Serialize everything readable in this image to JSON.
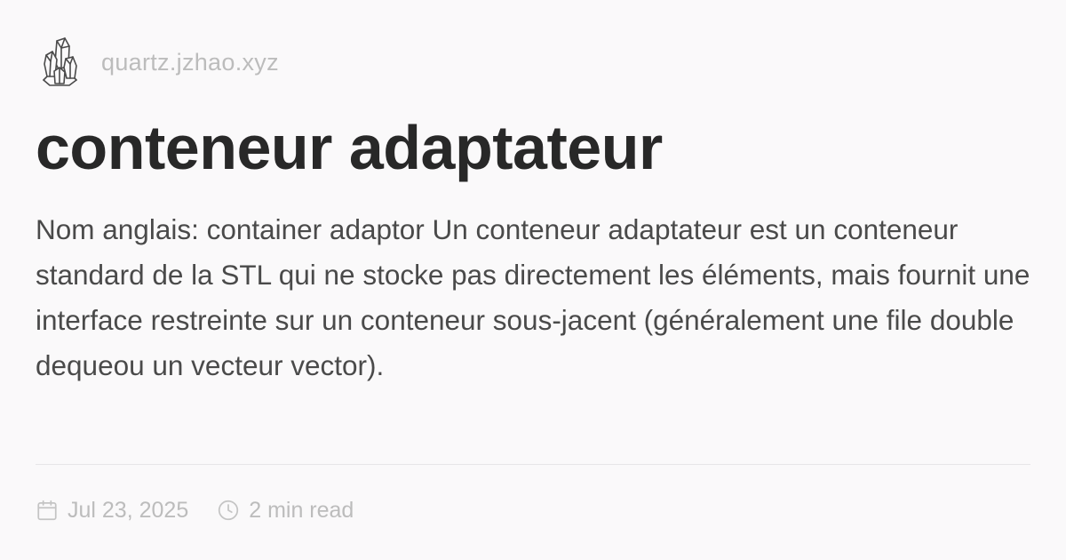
{
  "site": {
    "url": "quartz.jzhao.xyz",
    "logo_icon": "crystal-cluster-icon"
  },
  "page": {
    "title": "conteneur adaptateur",
    "description": "Nom anglais: container adaptor Un conteneur adaptateur est un conteneur standard de la STL qui ne stocke pas directement les éléments, mais fournit une interface restreinte sur un conteneur sous-jacent (généralement une file double dequeou un vecteur vector)."
  },
  "meta": {
    "date": "Jul 23, 2025",
    "date_icon": "calendar-icon",
    "reading_time": "2 min read",
    "reading_time_icon": "clock-icon"
  },
  "colors": {
    "background": "#faf9fa",
    "title": "#282828",
    "body_text": "#4a4a4a",
    "muted_text": "#bcbcbc",
    "divider": "#e7e6e8"
  }
}
